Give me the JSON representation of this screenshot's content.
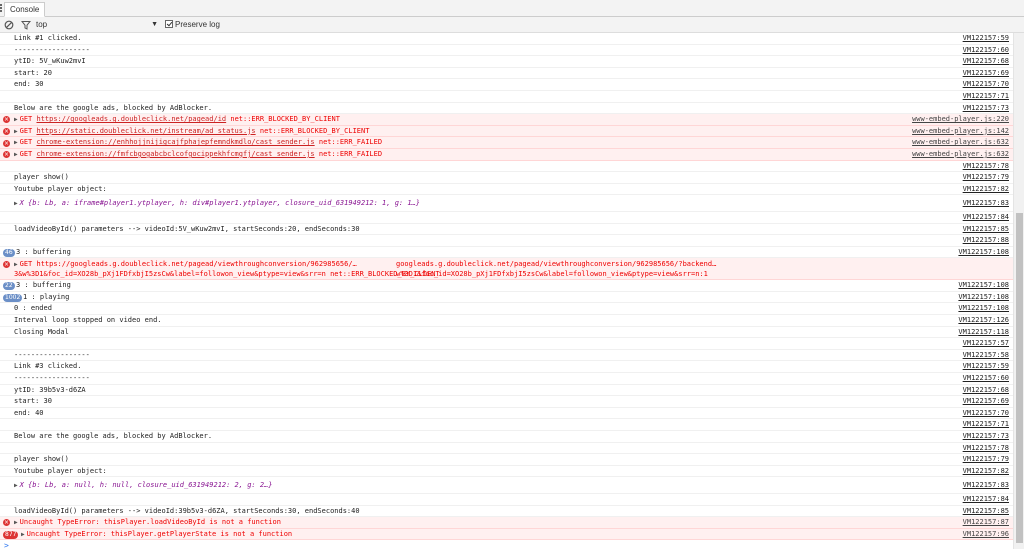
{
  "tab": {
    "label": "Console"
  },
  "toolbar": {
    "context": "top",
    "preserve_log": "Preserve log"
  },
  "log": [
    {
      "kind": "log",
      "text": "Link #1 clicked.",
      "src": "VM122157:59"
    },
    {
      "kind": "log",
      "text": "------------------",
      "src": "VM122157:60"
    },
    {
      "kind": "log",
      "text": "ytID: 5V_wKuw2mvI",
      "src": "VM122157:68"
    },
    {
      "kind": "log",
      "text": "start: 20",
      "src": "VM122157:69"
    },
    {
      "kind": "log",
      "text": "end: 30",
      "src": "VM122157:70"
    },
    {
      "kind": "log",
      "text": "",
      "src": "VM122157:71"
    },
    {
      "kind": "log",
      "text": "Below are the google ads, blocked by AdBlocker.",
      "src": "VM122157:73"
    },
    {
      "kind": "error",
      "prefix": "GET ",
      "url": "https://googleads.g.doubleclick.net/pagead/id",
      "suffix": " net::ERR_BLOCKED_BY_CLIENT",
      "src": "www-embed-player.js:220"
    },
    {
      "kind": "error",
      "prefix": "GET ",
      "url": "https://static.doubleclick.net/instream/ad_status.js",
      "suffix": " net::ERR_BLOCKED_BY_CLIENT",
      "src": "www-embed-player.js:142"
    },
    {
      "kind": "error",
      "prefix": "GET ",
      "url": "chrome-extension://enhhojjnijigcajfphajepfemndkmdlo/cast_sender.js",
      "suffix": " net::ERR_FAILED",
      "src": "www-embed-player.js:632"
    },
    {
      "kind": "error",
      "prefix": "GET ",
      "url": "chrome-extension://fmfcbgogabcbclcofgocippekhfcmgfj/cast_sender.js",
      "suffix": " net::ERR_FAILED",
      "src": "www-embed-player.js:632"
    },
    {
      "kind": "log",
      "text": "",
      "src": "VM122157:78"
    },
    {
      "kind": "log",
      "text": "player show()",
      "src": "VM122157:79"
    },
    {
      "kind": "log",
      "text": "Youtube player object:",
      "src": "VM122157:82"
    },
    {
      "kind": "object",
      "text": "X {b: Lb, a: iframe#player1.ytplayer, h: div#player1.ytplayer, closure_uid_631949212: 1, g: 1…}",
      "src": "VM122157:83"
    },
    {
      "kind": "log",
      "text": "",
      "src": "VM122157:84"
    },
    {
      "kind": "log",
      "text": "loadVideoById() parameters --> videoId:5V_wKuw2mvI, startSeconds:20, endSeconds:30",
      "src": "VM122157:85"
    },
    {
      "kind": "log",
      "text": "",
      "src": "VM122157:88"
    },
    {
      "kind": "badge",
      "badge": "46",
      "badgeColor": "blue",
      "text": "3 : buffering",
      "src": "VM122157:108"
    },
    {
      "kind": "multi",
      "l1": "GET https://googleads.g.doubleclick.net/pagead/viewthroughconversion/962985656/…",
      "l1b": "googleads.g.doubleclick.net/pagead/viewthroughconversion/962985656/?backend…w%3D1&foc_id=XO28b_pXj1FDfxbjI5zsCw&label=followon_view&ptype=view&srr=n:1",
      "l2": "3&w%3D1&foc_id=XO28b_pXj1FDfxbjI5zsCw&label=followon_view&ptype=view&srr=n net::ERR_BLOCKED_BY_CLIENT"
    },
    {
      "kind": "badge",
      "badge": "22",
      "badgeColor": "blue",
      "text": "3 : buffering",
      "src": "VM122157:108"
    },
    {
      "kind": "badge",
      "badge": "1002",
      "badgeColor": "blue",
      "text": "1 : playing",
      "src": "VM122157:108"
    },
    {
      "kind": "log",
      "text": "0 : ended",
      "src": "VM122157:108"
    },
    {
      "kind": "log",
      "text": "Interval loop stopped on video end.",
      "src": "VM122157:126"
    },
    {
      "kind": "log",
      "text": "Closing Modal",
      "src": "VM122157:118"
    },
    {
      "kind": "log",
      "text": "",
      "src": "VM122157:57"
    },
    {
      "kind": "log",
      "text": "------------------",
      "src": "VM122157:58"
    },
    {
      "kind": "log",
      "text": "Link #3 clicked.",
      "src": "VM122157:59"
    },
    {
      "kind": "log",
      "text": "------------------",
      "src": "VM122157:60"
    },
    {
      "kind": "log",
      "text": "ytID: 39b5v3-d6ZA",
      "src": "VM122157:68"
    },
    {
      "kind": "log",
      "text": "start: 30",
      "src": "VM122157:69"
    },
    {
      "kind": "log",
      "text": "end: 40",
      "src": "VM122157:70"
    },
    {
      "kind": "log",
      "text": "",
      "src": "VM122157:71"
    },
    {
      "kind": "log",
      "text": "Below are the google ads, blocked by AdBlocker.",
      "src": "VM122157:73"
    },
    {
      "kind": "log",
      "text": "",
      "src": "VM122157:78"
    },
    {
      "kind": "log",
      "text": "player show()",
      "src": "VM122157:79"
    },
    {
      "kind": "log",
      "text": "Youtube player object:",
      "src": "VM122157:82"
    },
    {
      "kind": "object",
      "text": "X {b: Lb, a: null, h: null, closure_uid_631949212: 2, g: 2…}",
      "src": "VM122157:83"
    },
    {
      "kind": "log",
      "text": "",
      "src": "VM122157:84"
    },
    {
      "kind": "log",
      "text": "loadVideoById() parameters --> videoId:39b5v3-d6ZA, startSeconds:30, endSeconds:40",
      "src": "VM122157:85"
    },
    {
      "kind": "uncaught",
      "text": "Uncaught TypeError: thisPlayer.loadVideoById is not a function",
      "src": "VM122157:87"
    },
    {
      "kind": "uncaught",
      "badge": "877",
      "text": "Uncaught TypeError: thisPlayer.getPlayerState is not a function",
      "src": "VM122157:96"
    }
  ],
  "prompt": ">"
}
